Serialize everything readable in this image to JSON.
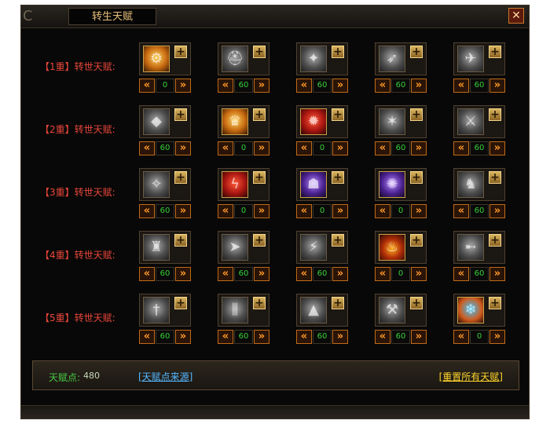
{
  "window": {
    "title": "转生天赋",
    "close_icon": "close-icon",
    "ornament": "C"
  },
  "rows": [
    {
      "label": "【1重】转世天赋:",
      "cells": [
        {
          "icon": "amulet-icon",
          "style": "gold",
          "glyph": "⚙",
          "value": "0"
        },
        {
          "icon": "helmet-icon",
          "style": "gray",
          "glyph": "⛑",
          "value": "60"
        },
        {
          "icon": "claw-strike-icon",
          "style": "gray",
          "glyph": "✦",
          "value": "60"
        },
        {
          "icon": "charge-icon",
          "style": "gray",
          "glyph": "➶",
          "value": "60"
        },
        {
          "icon": "blade-strike-icon",
          "style": "gray",
          "glyph": "✈",
          "value": "60"
        }
      ]
    },
    {
      "label": "【2重】转世天赋:",
      "cells": [
        {
          "icon": "shield-bash-icon",
          "style": "gray",
          "glyph": "◆",
          "value": "60"
        },
        {
          "icon": "golden-crown-icon",
          "style": "gold",
          "glyph": "♛",
          "value": "0"
        },
        {
          "icon": "fire-bomb-icon",
          "style": "red",
          "glyph": "✹",
          "value": "0"
        },
        {
          "icon": "thorn-icon",
          "style": "gray",
          "glyph": "✶",
          "value": "60"
        },
        {
          "icon": "mace-icon",
          "style": "gray",
          "glyph": "⚔",
          "value": "60"
        }
      ]
    },
    {
      "label": "【3重】转世天赋:",
      "cells": [
        {
          "icon": "shuriken-icon",
          "style": "gray",
          "glyph": "✧",
          "value": "60"
        },
        {
          "icon": "lightning-icon",
          "style": "red",
          "glyph": "ϟ",
          "value": "0"
        },
        {
          "icon": "shadow-beast-icon",
          "style": "purple",
          "glyph": "☗",
          "value": "0"
        },
        {
          "icon": "dark-orb-icon",
          "style": "purple",
          "glyph": "✺",
          "value": "0"
        },
        {
          "icon": "warrior-icon",
          "style": "gray",
          "glyph": "♞",
          "value": "60"
        }
      ]
    },
    {
      "label": "【4重】转世天赋:",
      "cells": [
        {
          "icon": "warhelm-icon",
          "style": "gray",
          "glyph": "♜",
          "value": "60"
        },
        {
          "icon": "spear-icon",
          "style": "gray",
          "glyph": "➤",
          "value": "60"
        },
        {
          "icon": "slash-icon",
          "style": "gray",
          "glyph": "⚡",
          "value": "60"
        },
        {
          "icon": "flame-warrior-icon",
          "style": "fire",
          "glyph": "♨",
          "value": "0"
        },
        {
          "icon": "arrow-volley-icon",
          "style": "gray",
          "glyph": "➸",
          "value": "60"
        }
      ]
    },
    {
      "label": "【5重】转世天赋:",
      "cells": [
        {
          "icon": "dagger-icon",
          "style": "gray",
          "glyph": "†",
          "value": "60"
        },
        {
          "icon": "rain-blades-icon",
          "style": "gray",
          "glyph": "⫼",
          "value": "60"
        },
        {
          "icon": "spikes-icon",
          "style": "gray",
          "glyph": "▲",
          "value": "60"
        },
        {
          "icon": "hammer-icon",
          "style": "gray",
          "glyph": "⚒",
          "value": "60"
        },
        {
          "icon": "frost-fire-icon",
          "style": "blue",
          "glyph": "❄",
          "value": "0"
        }
      ]
    }
  ],
  "controls": {
    "plus": "+",
    "left_arrow": "«",
    "right_arrow": "»"
  },
  "footer": {
    "points_label": "天赋点:",
    "points_value": "480",
    "source_link": "[天赋点来源]",
    "reset_link": "[重置所有天赋]"
  }
}
